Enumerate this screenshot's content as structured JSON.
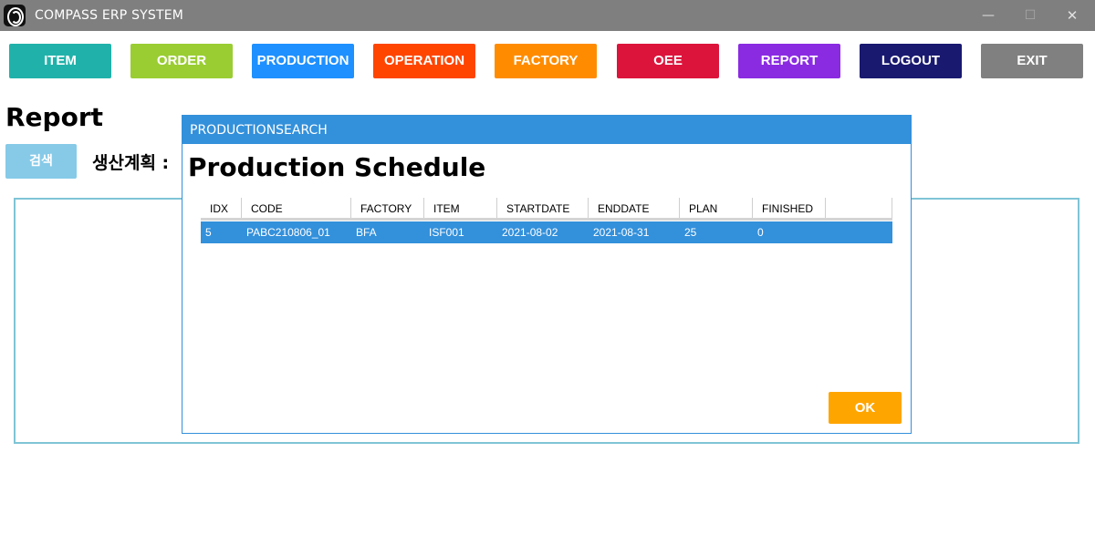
{
  "window": {
    "title": "COMPASS ERP SYSTEM",
    "min_glyph": "—",
    "max_glyph": "☐",
    "close_glyph": "✕"
  },
  "nav": {
    "item": {
      "label": "ITEM",
      "color": "#20b2aa"
    },
    "order": {
      "label": "ORDER",
      "color": "#9acd32"
    },
    "production": {
      "label": "PRODUCTION",
      "color": "#1e90ff"
    },
    "operation": {
      "label": "OPERATION",
      "color": "#ff4500"
    },
    "factory": {
      "label": "FACTORY",
      "color": "#ff8c00"
    },
    "oee": {
      "label": "OEE",
      "color": "#dc143c"
    },
    "report": {
      "label": "REPORT",
      "color": "#8a2be2"
    },
    "logout": {
      "label": "LOGOUT",
      "color": "#191970"
    },
    "exit": {
      "label": "EXIT",
      "color": "#808080"
    }
  },
  "page": {
    "title": "Report",
    "search_label": "검색",
    "plan_label": "생산계획 :"
  },
  "dialog": {
    "title": "PRODUCTIONSEARCH",
    "heading": "Production Schedule",
    "ok_label": "OK",
    "columns": [
      "IDX",
      "CODE",
      "FACTORY",
      "ITEM",
      "STARTDATE",
      "ENDDATE",
      "PLAN",
      "FINISHED"
    ],
    "rows": [
      [
        "5",
        "PABC210806_01",
        "BFA",
        "ISF001",
        "2021-08-02",
        "2021-08-31",
        "25",
        "0"
      ]
    ],
    "selected_row_color": "#3390db",
    "ok_color": "#ffa500"
  }
}
